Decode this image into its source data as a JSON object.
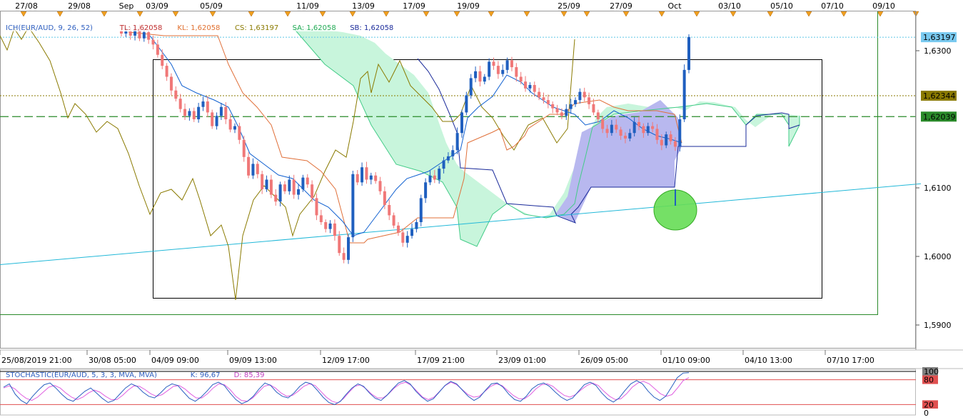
{
  "chart_data": {
    "type": "candlestick",
    "symbol": "EUR/AUD",
    "indicator_legend": [
      {
        "text": "ICH(EUR/AUD, 9, 26, 52)",
        "color": "#3060c0"
      },
      {
        "text": "TL: 1,62058",
        "color": "#c03030"
      },
      {
        "text": "KL: 1,62058",
        "color": "#e07030"
      },
      {
        "text": "CS: 1,63197",
        "color": "#8a7a00"
      },
      {
        "text": "SA: 1,62058",
        "color": "#22aa55"
      },
      {
        "text": "SB: 1,62058",
        "color": "#1a2a9a"
      }
    ],
    "top_dates": [
      "27/08",
      "29/08",
      "Sep",
      "03/09",
      "05/09",
      "11/09",
      "13/09",
      "17/09",
      "19/09",
      "25/09",
      "27/09",
      "Oct",
      "03/10",
      "05/10",
      "07/10",
      "09/10"
    ],
    "bottom_dates": [
      "25/08/2019 21:00",
      "30/08 05:00",
      "04/09 09:00",
      "09/09 13:00",
      "12/09 17:00",
      "17/09 21:00",
      "23/09 01:00",
      "26/09 05:00",
      "01/10 09:00",
      "04/10 13:00",
      "07/10 17:00"
    ],
    "ylim": [
      1.5885,
      1.635
    ],
    "y_ticks": [
      1.59,
      1.6,
      1.61,
      1.63
    ],
    "y_tick_labels": [
      "1,5900",
      "1,6000",
      "1,6100",
      "1,6300"
    ],
    "price_tags": [
      {
        "label": "1,63197",
        "value": 1.63197,
        "bg": "#79c9ef",
        "fg": "#000000"
      },
      {
        "label": "1,62344",
        "value": 1.62344,
        "bg": "#8a7a00",
        "fg": "#000000"
      },
      {
        "label": "1,62039",
        "value": 1.62039,
        "bg": "#2a8a2a",
        "fg": "#ffffff"
      }
    ],
    "horizontal_lines": [
      {
        "value": 1.63197,
        "color": "#5fc8e8",
        "style": "dotted"
      },
      {
        "value": 1.62344,
        "color": "#8a7a00",
        "style": "dotted"
      },
      {
        "value": 1.62039,
        "color": "#2a8a2a",
        "style": "dashed"
      }
    ],
    "candles_close": [
      1.6325,
      1.6328,
      1.6322,
      1.633,
      1.6318,
      1.6327,
      1.6316,
      1.6309,
      1.6294,
      1.6278,
      1.6262,
      1.6242,
      1.623,
      1.6215,
      1.6205,
      1.6212,
      1.62,
      1.6218,
      1.6226,
      1.621,
      1.619,
      1.6205,
      1.6218,
      1.62,
      1.6185,
      1.619,
      1.617,
      1.6145,
      1.6118,
      1.6135,
      1.612,
      1.6098,
      1.6112,
      1.609,
      1.608,
      1.6105,
      1.6095,
      1.6112,
      1.609,
      1.6098,
      1.6115,
      1.6105,
      1.6085,
      1.606,
      1.605,
      1.604,
      1.6048,
      1.603,
      1.6005,
      1.5995,
      1.6028,
      1.612,
      1.6108,
      1.613,
      1.6112,
      1.6118,
      1.611,
      1.6095,
      1.6075,
      1.606,
      1.6045,
      1.6035,
      1.602,
      1.603,
      1.604,
      1.605,
      1.6085,
      1.6108,
      1.6118,
      1.6112,
      1.6128,
      1.614,
      1.6146,
      1.6155,
      1.618,
      1.621,
      1.6235,
      1.626,
      1.627,
      1.6255,
      1.6262,
      1.6284,
      1.6278,
      1.6266,
      1.6272,
      1.6286,
      1.6276,
      1.6262,
      1.6255,
      1.6245,
      1.625,
      1.624,
      1.6232,
      1.6228,
      1.6222,
      1.6216,
      1.621,
      1.6205,
      1.6215,
      1.6222,
      1.6228,
      1.624,
      1.6232,
      1.6222,
      1.621,
      1.62,
      1.6186,
      1.618,
      1.6192,
      1.6185,
      1.6176,
      1.6172,
      1.618,
      1.6196,
      1.619,
      1.618,
      1.619,
      1.6186,
      1.617,
      1.6162,
      1.6178,
      1.6168,
      1.616,
      1.62,
      1.6272,
      1.632
    ],
    "cloud_upper_line": [
      1.633,
      1.632,
      1.629,
      1.626,
      1.6225,
      1.62,
      1.6185,
      1.616,
      1.614,
      1.6135,
      1.6125,
      1.6105,
      1.6088,
      1.608,
      1.6078,
      1.608,
      1.609,
      1.6145,
      1.6165,
      1.62,
      1.621,
      1.6215,
      1.6205,
      1.619,
      1.619
    ],
    "cloud_lower_line": [
      1.633,
      1.632,
      1.631,
      1.6285,
      1.626,
      1.6238,
      1.622,
      1.6195,
      1.6175,
      1.615,
      1.6125,
      1.6115,
      1.608,
      1.606,
      1.604,
      1.607,
      1.609,
      1.612,
      1.616,
      1.6175,
      1.6178,
      1.6172,
      1.6172,
      1.618,
      1.619
    ],
    "trendline": [
      [
        0,
        1.5988
      ],
      [
        1290,
        1.6106
      ]
    ],
    "stochastic": {
      "legend": [
        {
          "text": "STOCHASTIC(EUR/AUD, 5, 3, 3, MVA, MVA)",
          "color": "#3060c0"
        },
        {
          "text": "K: 96,67",
          "color": "#3060c0"
        },
        {
          "text": "D: 85,39",
          "color": "#c040c0"
        }
      ],
      "ylim": [
        0,
        100
      ],
      "levels": [
        {
          "value": 100,
          "label": "100",
          "bg": "#808080",
          "fg": "#000000"
        },
        {
          "value": 80,
          "label": "80",
          "bg": "#e05050",
          "fg": "#000000"
        },
        {
          "value": 20,
          "label": "20",
          "bg": "#e05050",
          "fg": "#000000"
        },
        {
          "value": 0,
          "label": "0",
          "bg": "#ffffff",
          "fg": "#000000"
        }
      ],
      "k_values": [
        62,
        70,
        45,
        30,
        22,
        40,
        55,
        68,
        72,
        60,
        45,
        33,
        28,
        40,
        52,
        60,
        48,
        35,
        25,
        30,
        45,
        60,
        70,
        64,
        50,
        40,
        36,
        48,
        62,
        70,
        66,
        50,
        35,
        28,
        38,
        52,
        68,
        74,
        66,
        48,
        32,
        22,
        28,
        40,
        58,
        72,
        66,
        50,
        40,
        36,
        48,
        64,
        74,
        70,
        55,
        38,
        25,
        20,
        28,
        45,
        60,
        70,
        64,
        48,
        35,
        30,
        42,
        58,
        72,
        78,
        70,
        52,
        38,
        28,
        34,
        50,
        66,
        76,
        70,
        55,
        40,
        30,
        38,
        55,
        70,
        72,
        62,
        45,
        32,
        28,
        40,
        58,
        68,
        72,
        64,
        50,
        38,
        30,
        36,
        52,
        68,
        74,
        66,
        48,
        34,
        26,
        36,
        54,
        70,
        78,
        70,
        52,
        38,
        30,
        40,
        62,
        85,
        96,
        97
      ],
      "d_values": [
        60,
        65,
        58,
        45,
        35,
        30,
        38,
        50,
        62,
        66,
        60,
        48,
        38,
        32,
        38,
        48,
        55,
        50,
        40,
        32,
        32,
        42,
        55,
        65,
        64,
        56,
        46,
        40,
        44,
        54,
        64,
        66,
        58,
        46,
        36,
        36,
        46,
        60,
        70,
        68,
        56,
        40,
        30,
        28,
        36,
        50,
        64,
        68,
        60,
        48,
        40,
        42,
        52,
        64,
        70,
        66,
        52,
        38,
        28,
        24,
        34,
        50,
        64,
        68,
        58,
        45,
        36,
        36,
        46,
        60,
        70,
        74,
        66,
        52,
        38,
        32,
        38,
        52,
        66,
        74,
        68,
        56,
        44,
        38,
        40,
        52,
        64,
        70,
        66,
        54,
        42,
        34,
        34,
        44,
        58,
        68,
        70,
        64,
        52,
        42,
        38,
        44,
        56,
        66,
        72,
        66,
        52,
        40,
        32,
        34,
        46,
        62,
        72,
        76,
        70,
        58,
        46,
        40,
        44,
        60,
        78,
        85
      ]
    }
  }
}
